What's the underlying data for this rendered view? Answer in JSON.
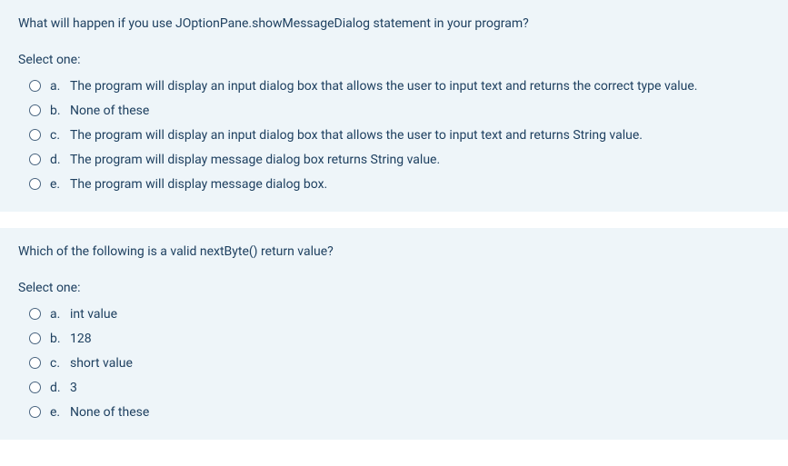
{
  "questions": [
    {
      "text": "What will happen if you use JOptionPane.showMessageDialog statement in your program?",
      "select_label": "Select one:",
      "options": [
        {
          "letter": "a.",
          "text": "The program will display an input dialog box that allows the user to input text and returns the correct type value."
        },
        {
          "letter": "b.",
          "text": "None of these"
        },
        {
          "letter": "c.",
          "text": "The program will display an input dialog box that allows the user to input text and returns String value."
        },
        {
          "letter": "d.",
          "text": "The program will display message dialog box returns String value."
        },
        {
          "letter": "e.",
          "text": "The program will display message dialog box."
        }
      ]
    },
    {
      "text": "Which of the following is a valid nextByte() return value?",
      "select_label": "Select one:",
      "options": [
        {
          "letter": "a.",
          "text": "int value"
        },
        {
          "letter": "b.",
          "text": "128"
        },
        {
          "letter": "c.",
          "text": "short value"
        },
        {
          "letter": "d.",
          "text": "3"
        },
        {
          "letter": "e.",
          "text": "None of these"
        }
      ]
    }
  ]
}
